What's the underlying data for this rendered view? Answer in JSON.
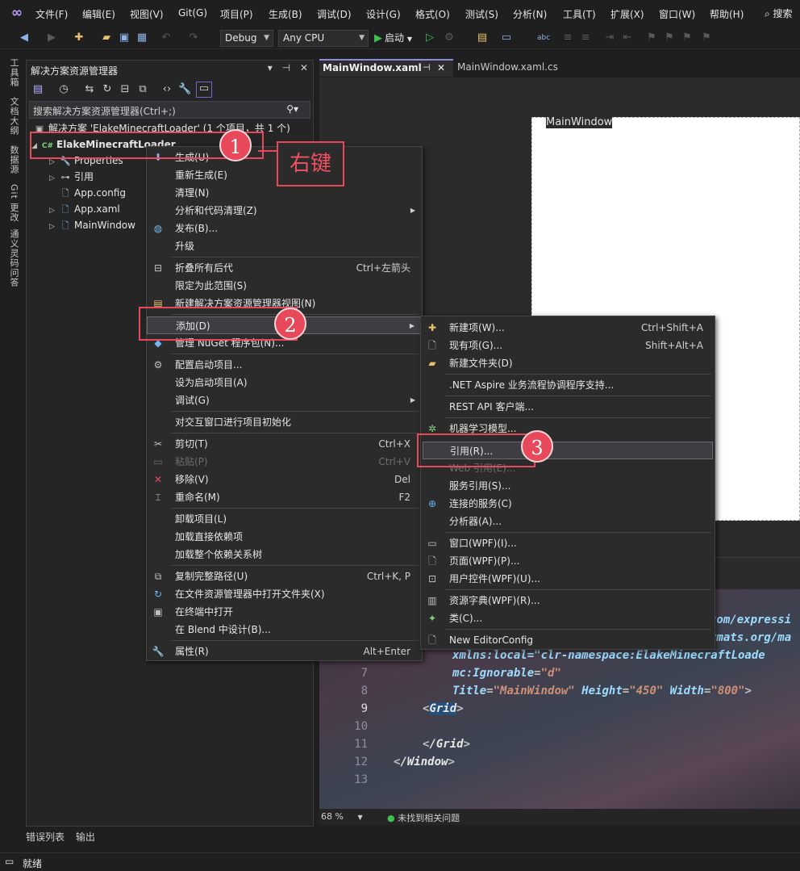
{
  "menubar": {
    "items": [
      "文件(F)",
      "编辑(E)",
      "视图(V)",
      "Git(G)",
      "项目(P)",
      "生成(B)",
      "调试(D)",
      "设计(G)",
      "格式(O)",
      "测试(S)",
      "分析(N)",
      "工具(T)",
      "扩展(X)",
      "窗口(W)",
      "帮助(H)"
    ],
    "search_label": "搜索"
  },
  "toolbar": {
    "config_value": "Debug",
    "platform_value": "Any CPU",
    "start_label": "启动"
  },
  "left_strip": [
    "工具箱",
    "文档大纲",
    "数据源",
    "Git 更改",
    "通义灵码问答"
  ],
  "solution_explorer": {
    "title": "解决方案资源管理器",
    "search_placeholder": "搜索解决方案资源管理器(Ctrl+;)",
    "tree": [
      {
        "label": "解决方案 'ElakeMinecraftLoader' (1 个项目，共 1 个)",
        "icon": "solution-icon"
      },
      {
        "label": "ElakeMinecraftLoader",
        "icon": "csharp-project-icon"
      },
      {
        "label": "Properties",
        "icon": "wrench-icon"
      },
      {
        "label": "引用",
        "icon": "references-icon"
      },
      {
        "label": "App.config",
        "icon": "config-file-icon"
      },
      {
        "label": "App.xaml",
        "icon": "xaml-file-icon"
      },
      {
        "label": "MainWindow",
        "icon": "xaml-file-icon"
      }
    ]
  },
  "editor": {
    "tab_active": "MainWindow.xaml",
    "tab_other": "MainWindow.xaml.cs",
    "window_title": "MainWindow",
    "zoom": "68 %",
    "issues": "未找到相关问题",
    "code_lines": [
      {
        "num": "7",
        "attr": "mc:Ignorable",
        "value": "\"d\""
      },
      {
        "num": "8",
        "attr": "Title",
        "value": "\"MainWindow\"",
        "attr2": "Height",
        "value2": "\"450\"",
        "attr3": "Width",
        "value3": "\"800\""
      },
      {
        "num": "9",
        "tag": "Grid"
      },
      {
        "num": "10"
      },
      {
        "num": "11",
        "tag": "/Grid"
      },
      {
        "num": "12",
        "tag": "/Window"
      },
      {
        "num": "13"
      }
    ],
    "xmlns_local": "xmlns:local=\"clr-namespace:ElakeMinecraftLoade",
    "link1": "com/expressi",
    "link2": "rmats.org/ma"
  },
  "context_menu_main": [
    {
      "label": "生成(U)",
      "icon": "build-icon"
    },
    {
      "label": "重新生成(E)"
    },
    {
      "label": "清理(N)"
    },
    {
      "label": "分析和代码清理(Z)",
      "submenu": true
    },
    {
      "label": "发布(B)...",
      "icon": "globe-icon"
    },
    {
      "label": "升级"
    },
    {
      "label": "折叠所有后代",
      "shortcut": "Ctrl+左箭头",
      "icon": "collapse-icon"
    },
    {
      "label": "限定为此范围(S)"
    },
    {
      "label": "新建解决方案资源管理器视图(N)",
      "icon": "new-view-icon"
    },
    {
      "label": "添加(D)",
      "submenu": true
    },
    {
      "label": "管理 NuGet 程序包(N)...",
      "icon": "nuget-icon"
    },
    {
      "label": "配置启动项目...",
      "icon": "gear-icon"
    },
    {
      "label": "设为启动项目(A)"
    },
    {
      "label": "调试(G)",
      "submenu": true
    },
    {
      "label": "对交互窗口进行项目初始化"
    },
    {
      "label": "剪切(T)",
      "shortcut": "Ctrl+X",
      "icon": "cut-icon"
    },
    {
      "label": "粘贴(P)",
      "shortcut": "Ctrl+V",
      "icon": "paste-icon",
      "disabled": true
    },
    {
      "label": "移除(V)",
      "shortcut": "Del",
      "icon": "remove-icon"
    },
    {
      "label": "重命名(M)",
      "shortcut": "F2",
      "icon": "rename-icon"
    },
    {
      "label": "卸载项目(L)"
    },
    {
      "label": "加载直接依赖项"
    },
    {
      "label": "加载整个依赖关系树"
    },
    {
      "label": "复制完整路径(U)",
      "shortcut": "Ctrl+K, P",
      "icon": "copy-icon"
    },
    {
      "label": "在文件资源管理器中打开文件夹(X)",
      "icon": "open-folder-icon"
    },
    {
      "label": "在终端中打开",
      "icon": "terminal-icon"
    },
    {
      "label": "在 Blend 中设计(B)..."
    },
    {
      "label": "属性(R)",
      "shortcut": "Alt+Enter",
      "icon": "wrench-icon"
    }
  ],
  "context_menu_add": [
    {
      "label": "新建项(W)...",
      "shortcut": "Ctrl+Shift+A",
      "icon": "new-item-icon"
    },
    {
      "label": "现有项(G)...",
      "shortcut": "Shift+Alt+A",
      "icon": "existing-item-icon"
    },
    {
      "label": "新建文件夹(D)",
      "icon": "new-folder-icon"
    },
    {
      "label": ".NET Aspire 业务流程协调程序支持..."
    },
    {
      "label": "REST API 客户端..."
    },
    {
      "label": "机器学习模型...",
      "icon": "ml-icon"
    },
    {
      "label": "引用(R)..."
    },
    {
      "label": "Web 引用(E)...",
      "disabled": true
    },
    {
      "label": "服务引用(S)..."
    },
    {
      "label": "连接的服务(C)",
      "icon": "connected-service-icon"
    },
    {
      "label": "分析器(A)..."
    },
    {
      "label": "窗口(WPF)(I)...",
      "icon": "window-icon"
    },
    {
      "label": "页面(WPF)(P)...",
      "icon": "page-icon"
    },
    {
      "label": "用户控件(WPF)(U)...",
      "icon": "user-control-icon"
    },
    {
      "label": "资源字典(WPF)(R)...",
      "icon": "resource-dict-icon"
    },
    {
      "label": "类(C)...",
      "icon": "class-icon"
    },
    {
      "label": "New EditorConfig",
      "icon": "file-icon"
    }
  ],
  "annotations": {
    "badge1": "1",
    "badge2": "2",
    "badge3": "3",
    "right_click_text": "右键",
    "accent": "#e8495a"
  },
  "bottom_tabs": [
    "错误列表",
    "输出"
  ],
  "status": "就绪"
}
